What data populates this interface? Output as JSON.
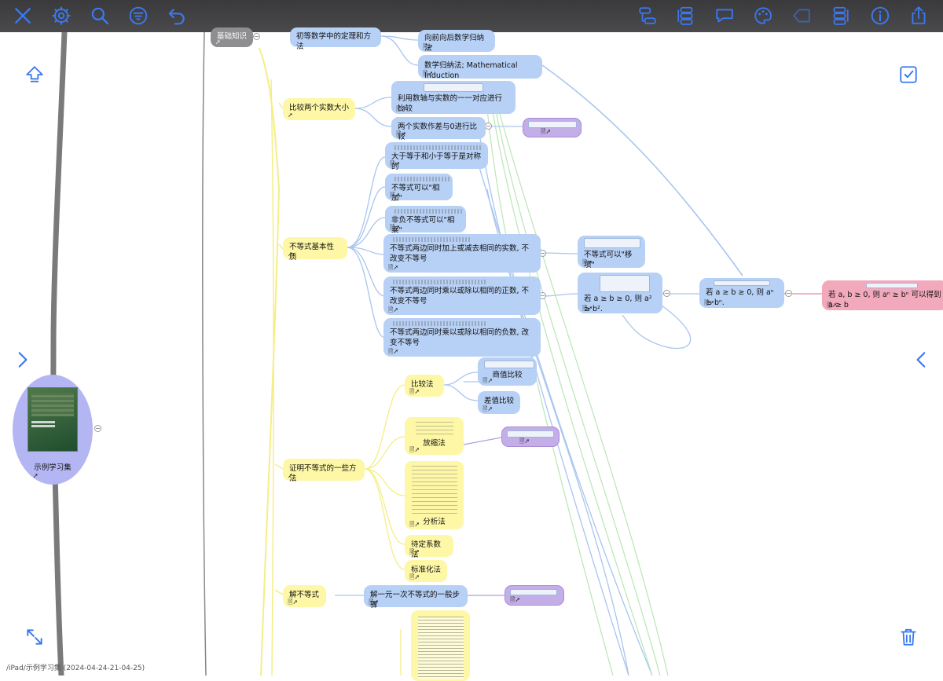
{
  "toolbar": {
    "left": [
      "close-icon",
      "settings-icon",
      "search-icon",
      "filter-icon",
      "undo-icon"
    ],
    "right": [
      "layout-left-icon",
      "layout-center-icon",
      "comment-icon",
      "color-icon",
      "tag-icon",
      "layout-right-icon",
      "info-icon",
      "share-icon"
    ],
    "accent": "#3a78f2"
  },
  "root": {
    "label": "示例学习集"
  },
  "nodes": {
    "jichu": "基础知识",
    "chudeng": "初等数学中的定理和方法",
    "xiangqian": "向前向后数学归纳法",
    "guina": "数学归纳法; Mathematical Induction",
    "bijiao2": "比较两个实数大小",
    "shuzhou": "利用数轴与实数的一一对应进行比较",
    "zuocha": "两个实数作差与0进行比较",
    "dayu": "大于等于和小于等于是对称的",
    "xiangjia": "不等式可以\"相加\"",
    "xiangcheng": "非负不等式可以\"相乘\"",
    "jiben": "不等式基本性质",
    "jiajian": "不等式两边同时加上或减去相同的实数, 不改变不等号",
    "zhengshu": "不等式两边同时乘以或除以相同的正数, 不改变不等号",
    "fushu": "不等式两边同时乘以或除以相同的负数, 改变不等号",
    "yixiang": "不等式可以\"移项\"",
    "pingfang": "若 a ≥ b ≥ 0, 则 a² ≥ b².",
    "nci": "若 a ≥ b ≥ 0, 则 aⁿ ≥ bⁿ.",
    "kaifang": "若 a, b ≥ 0, 则 aⁿ ≥ bⁿ 可以得到 a ≥ b",
    "bijiaofa": "比较法",
    "shangzhi": "商值比较",
    "chazhi": "差值比较",
    "zhengming": "证明不等式的一些方法",
    "fangsuo": "放缩法",
    "fenxi": "分析法",
    "daiding": "待定系数法",
    "biaozhun": "标准化法",
    "jie": "解不等式",
    "yiyuan": "解一元一次不等式的一般步骤"
  },
  "side": {
    "left": [
      "move-up-icon",
      "expand-right-icon",
      "fullscreen-icon"
    ],
    "right": [
      "select-checkbox-icon",
      "collapse-left-icon",
      "trash-icon"
    ]
  },
  "footer": {
    "path": "/iPad/示例学习集 (2024-04-24-21-04-25)"
  }
}
